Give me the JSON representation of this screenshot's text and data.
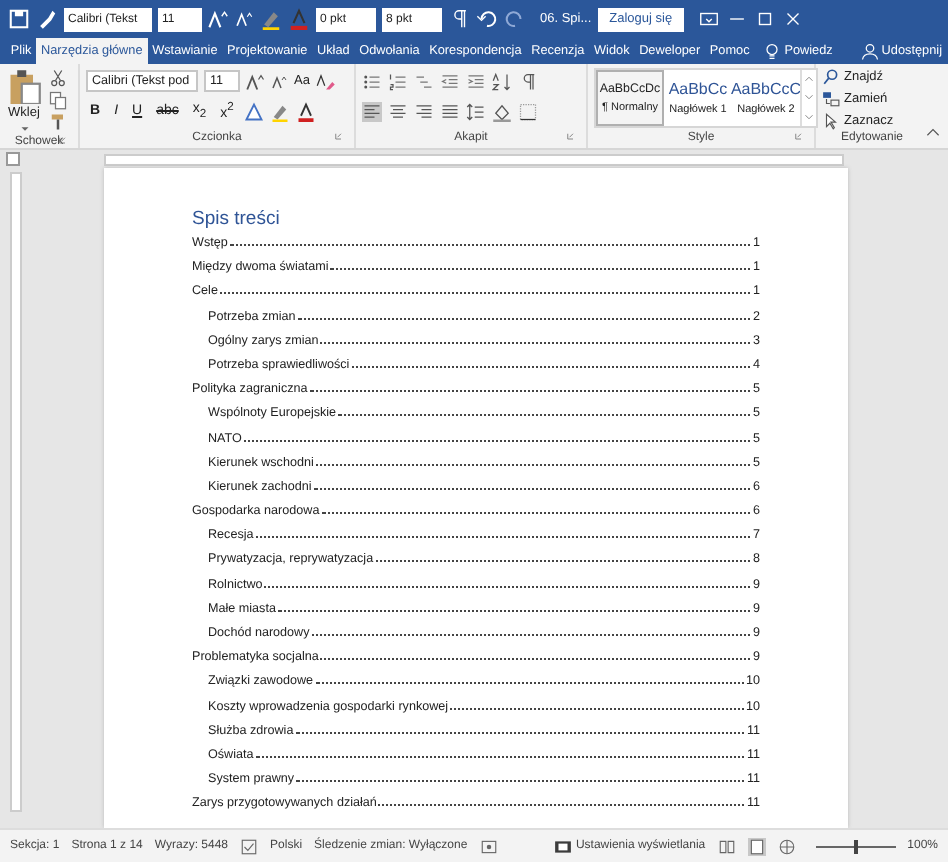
{
  "quick_access": {
    "font": "Calibri (Tekst",
    "size": "11",
    "spacing_before": "0 pkt",
    "spacing_after": "8 pkt"
  },
  "window": {
    "title": "06. Spi...",
    "sign_in": "Zaloguj się"
  },
  "tabs": [
    {
      "label": "Plik",
      "selected": false
    },
    {
      "label": "Narzędzia główne",
      "selected": true
    },
    {
      "label": "Wstawianie",
      "selected": false
    },
    {
      "label": "Projektowanie",
      "selected": false
    },
    {
      "label": "Układ",
      "selected": false
    },
    {
      "label": "Odwołania",
      "selected": false
    },
    {
      "label": "Korespondencja",
      "selected": false
    },
    {
      "label": "Recenzja",
      "selected": false
    },
    {
      "label": "Widok",
      "selected": false
    },
    {
      "label": "Deweloper",
      "selected": false
    },
    {
      "label": "Pomoc",
      "selected": false
    }
  ],
  "tell_me": "Powiedz",
  "share": "Udostępnij",
  "ribbon": {
    "clipboard": {
      "label": "Schowek",
      "paste": "Wklej"
    },
    "font": {
      "label": "Czcionka",
      "font_name": "Calibri (Tekst pod",
      "font_size": "11",
      "case": "Aa",
      "buttons": [
        "B",
        "I",
        "U",
        "abc",
        "x$_{2}$",
        "x$^{2}$"
      ]
    },
    "paragraph": {
      "label": "Akapit",
      "alignment": [
        {
          "selected": true
        },
        {
          "selected": false
        },
        {
          "selected": false
        },
        {
          "selected": false
        }
      ]
    },
    "styles": {
      "label": "Style",
      "items": [
        {
          "preview": "AaBbCcDc",
          "name": "¶ Normalny",
          "selected": true
        },
        {
          "preview": "AaBbCc",
          "name": "Nagłówek 1",
          "selected": false
        },
        {
          "preview": "AaBbCcC",
          "name": "Nagłówek 2",
          "selected": false
        }
      ]
    },
    "editing": {
      "label": "Edytowanie",
      "items": [
        "Znajdź",
        "Zamień",
        "Zaznacz"
      ]
    }
  },
  "document": {
    "heading": "Spis treści",
    "entries": [
      {
        "text": "Wstęp",
        "page": "1"
      },
      {
        "text": "Między dwoma światami",
        "page": "1"
      },
      {
        "text": "Cele",
        "page": "1",
        "children": [
          {
            "text": "Potrzeba zmian",
            "page": "2"
          },
          {
            "text": "Ogólny zarys zmian",
            "page": "3"
          },
          {
            "text": "Potrzeba sprawiedliwości",
            "page": "4"
          }
        ]
      },
      {
        "text": "Polityka zagraniczna",
        "page": "5",
        "children": [
          {
            "text": "Wspólnoty Europejskie",
            "page": "5"
          },
          {
            "text": "NATO",
            "page": "5"
          },
          {
            "text": "Kierunek wschodni",
            "page": "5"
          },
          {
            "text": "Kierunek zachodni",
            "page": "6"
          }
        ]
      },
      {
        "text": "Gospodarka narodowa",
        "page": "6",
        "children": [
          {
            "text": "Recesja",
            "page": "7"
          },
          {
            "text": "Prywatyzacja, reprywatyzacja",
            "page": "8"
          },
          {
            "text": "Rolnictwo",
            "page": "9"
          },
          {
            "text": "Małe miasta",
            "page": "9"
          },
          {
            "text": "Dochód narodowy",
            "page": "9"
          }
        ]
      },
      {
        "text": "Problematyka socjalna",
        "page": "9",
        "children": [
          {
            "text": "Związki zawodowe",
            "page": "10"
          },
          {
            "text": "Koszty wprowadzenia gospodarki rynkowej",
            "page": "10"
          },
          {
            "text": "Służba zdrowia",
            "page": "11"
          },
          {
            "text": "Oświata",
            "page": "11"
          },
          {
            "text": "System prawny",
            "page": "11"
          }
        ]
      },
      {
        "text": "Zarys przygotowywanych działań",
        "page": "11"
      }
    ]
  },
  "status_bar": {
    "section": "Sekcja: 1",
    "page": "Strona 1 z 14",
    "words": "Wyrazy: 5448",
    "language": "Polski",
    "track_changes": "Śledzenie zmian: Wyłączone",
    "display_settings": "Ustawienia wyświetlania",
    "views": [
      {
        "selected": false
      },
      {
        "selected": true
      },
      {
        "selected": false
      }
    ],
    "zoom_slider": {
      "level": 0.5
    },
    "zoom": "100%"
  }
}
